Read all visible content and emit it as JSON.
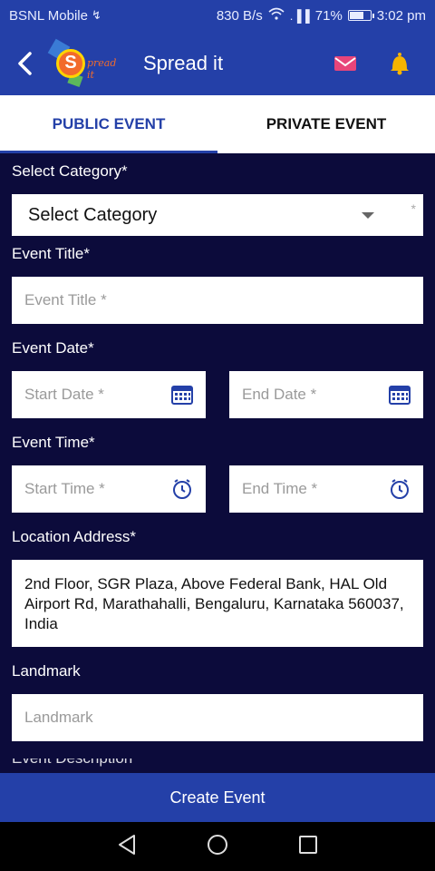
{
  "status": {
    "carrier": "BSNL Mobile",
    "usb_glyph": "↯",
    "speed": "830 B/s",
    "signal_glyph": ".▐▐",
    "battery": "71%",
    "battery_level": 0.71,
    "time": "3:02 pm"
  },
  "appbar": {
    "logo_letter": "S",
    "logo_word": "pread it",
    "title": "Spread it",
    "mail_icon": "mail-icon",
    "bell_icon": "bell-icon"
  },
  "tabs": [
    {
      "label": "PUBLIC EVENT",
      "active": true
    },
    {
      "label": "PRIVATE EVENT",
      "active": false
    }
  ],
  "form": {
    "category_label": "Select Category*",
    "category_value": "Select Category",
    "category_asterisk": "*",
    "title_label": "Event Title*",
    "title_placeholder": "Event Title *",
    "date_label": "Event Date*",
    "start_date_placeholder": "Start Date *",
    "end_date_placeholder": "End Date *",
    "time_label": "Event Time*",
    "start_time_placeholder": "Start Time *",
    "end_time_placeholder": "End Time *",
    "address_label": "Location Address*",
    "address_value": "2nd Floor, SGR Plaza, Above Federal Bank, HAL Old Airport Rd, Marathahalli, Bengaluru, Karnataka 560037, India",
    "landmark_label": "Landmark",
    "landmark_placeholder": "Landmark",
    "next_label_partial": "Event Description*"
  },
  "create_button": "Create Event",
  "colors": {
    "primary": "#2440a8",
    "background": "#0c0b3b",
    "accent_pink": "#e8457a",
    "bell_yellow": "#f6b400"
  }
}
